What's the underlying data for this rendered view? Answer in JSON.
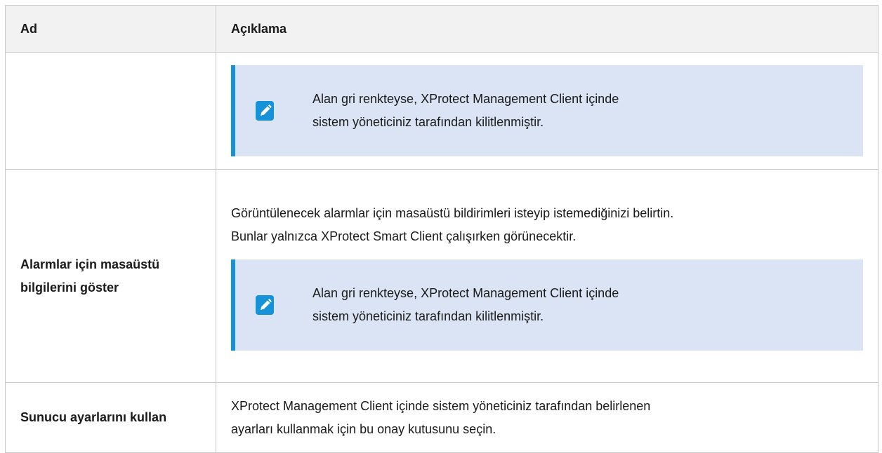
{
  "table": {
    "headers": {
      "name": "Ad",
      "description": "Açıklama"
    },
    "rows": [
      {
        "name": "",
        "note": {
          "line1": "Alan gri renkteyse, XProtect Management Client içinde",
          "line2": "sistem yöneticiniz tarafından kilitlenmiştir."
        }
      },
      {
        "name": "Alarmlar için masaüstü bilgilerini göster",
        "text_line1": "Görüntülenecek alarmlar için masaüstü bildirimleri isteyip istemediğinizi belirtin.",
        "text_line2": "Bunlar yalnızca XProtect Smart Client çalışırken görünecektir.",
        "note": {
          "line1": "Alan gri renkteyse, XProtect Management Client içinde",
          "line2": "sistem yöneticiniz tarafından kilitlenmiştir."
        }
      },
      {
        "name": "Sunucu ayarlarını kullan",
        "text_line1": "XProtect Management Client içinde sistem yöneticiniz tarafından belirlenen",
        "text_line2": "ayarları kullanmak için bu onay kutusunu seçin."
      }
    ]
  },
  "icons": {
    "note": "pencil-edit-icon"
  },
  "colors": {
    "note_bg": "#dbe4f4",
    "note_bar": "#1592d8",
    "icon": "#1592d8",
    "header_bg": "#f2f2f2"
  }
}
